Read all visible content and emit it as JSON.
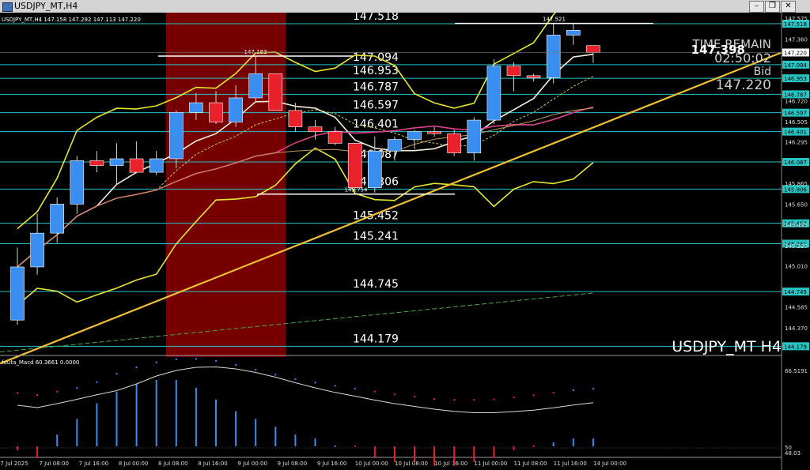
{
  "window": {
    "title": "USDJPY_MT,H4"
  },
  "header": {
    "symbol_info": "USDJPY_MT,H4 147.158 147.292 147.113 147.220",
    "indicator_info": "fuuta_Macd 60.3661  0.0000"
  },
  "overlay": {
    "time_remain_label": "TIME REMAIN",
    "time_remain": "02:50:02",
    "price_big": "147.398",
    "bid_label": "Bid",
    "bid_value": "147.220",
    "symbol_label": "USDJPY_MT H4"
  },
  "colors": {
    "bull": "#3a8ef0",
    "bear": "#e8212b",
    "bollinger": "#e6e62a",
    "trendline": "#f0c030",
    "ma_white": "#f2eedb",
    "ma_pink": "#e0408a",
    "level_line": "#27c4c4",
    "shade": "#8b0000"
  },
  "chart_data": {
    "type": "candlestick",
    "title": "USDJPY_MT H4",
    "y_range": [
      144.1,
      147.6
    ],
    "price_axis_ticks": [
      "147.575",
      "147.360",
      "147.220",
      "146.720",
      "146.505",
      "146.295",
      "145.865",
      "145.650",
      "145.435",
      "145.220",
      "145.010",
      "144.585",
      "144.370"
    ],
    "x_labels": [
      "7 Jul 2025",
      "7 Jul 08:00",
      "7 Jul 16:00",
      "8 Jul 00:00",
      "8 Jul 08:00",
      "8 Jul 16:00",
      "9 Jul 00:00",
      "9 Jul 08:00",
      "9 Jul 16:00",
      "10 Jul 00:00",
      "10 Jul 08:00",
      "10 Jul 16:00",
      "11 Jul 00:00",
      "11 Jul 08:00",
      "11 Jul 16:00",
      "14 Jul 00:00"
    ],
    "candles": [
      {
        "o": 144.45,
        "h": 145.2,
        "l": 144.4,
        "c": 145.0
      },
      {
        "o": 145.0,
        "h": 145.55,
        "l": 144.92,
        "c": 145.35
      },
      {
        "o": 145.35,
        "h": 145.72,
        "l": 145.25,
        "c": 145.65
      },
      {
        "o": 145.65,
        "h": 146.15,
        "l": 145.55,
        "c": 146.1
      },
      {
        "o": 146.1,
        "h": 146.2,
        "l": 145.98,
        "c": 146.05
      },
      {
        "o": 146.05,
        "h": 146.28,
        "l": 145.85,
        "c": 146.12
      },
      {
        "o": 146.12,
        "h": 146.3,
        "l": 145.97,
        "c": 145.98
      },
      {
        "o": 145.98,
        "h": 146.2,
        "l": 145.95,
        "c": 146.12
      },
      {
        "o": 146.12,
        "h": 146.62,
        "l": 146.02,
        "c": 146.6
      },
      {
        "o": 146.6,
        "h": 146.8,
        "l": 146.52,
        "c": 146.7
      },
      {
        "o": 146.7,
        "h": 146.82,
        "l": 146.48,
        "c": 146.5
      },
      {
        "o": 146.5,
        "h": 146.88,
        "l": 146.45,
        "c": 146.75
      },
      {
        "o": 146.75,
        "h": 147.18,
        "l": 146.7,
        "c": 147.0
      },
      {
        "o": 147.0,
        "h": 147.0,
        "l": 146.62,
        "c": 146.62
      },
      {
        "o": 146.62,
        "h": 146.7,
        "l": 146.4,
        "c": 146.45
      },
      {
        "o": 146.45,
        "h": 146.52,
        "l": 146.32,
        "c": 146.4
      },
      {
        "o": 146.4,
        "h": 146.45,
        "l": 146.26,
        "c": 146.28
      },
      {
        "o": 146.28,
        "h": 146.28,
        "l": 145.78,
        "c": 145.82
      },
      {
        "o": 145.82,
        "h": 146.35,
        "l": 145.77,
        "c": 146.2
      },
      {
        "o": 146.2,
        "h": 146.35,
        "l": 146.1,
        "c": 146.32
      },
      {
        "o": 146.32,
        "h": 146.42,
        "l": 146.22,
        "c": 146.4
      },
      {
        "o": 146.4,
        "h": 146.45,
        "l": 146.35,
        "c": 146.38
      },
      {
        "o": 146.38,
        "h": 146.42,
        "l": 146.15,
        "c": 146.18
      },
      {
        "o": 146.18,
        "h": 146.55,
        "l": 146.1,
        "c": 146.52
      },
      {
        "o": 146.52,
        "h": 147.15,
        "l": 146.48,
        "c": 147.08
      },
      {
        "o": 147.08,
        "h": 147.12,
        "l": 146.82,
        "c": 146.98
      },
      {
        "o": 146.98,
        "h": 147.0,
        "l": 146.92,
        "c": 146.96
      },
      {
        "o": 146.96,
        "h": 147.521,
        "l": 146.9,
        "c": 147.4
      },
      {
        "o": 147.4,
        "h": 147.521,
        "l": 147.3,
        "c": 147.45
      },
      {
        "o": 147.292,
        "h": 147.292,
        "l": 147.113,
        "c": 147.22
      }
    ],
    "levels": [
      147.518,
      147.094,
      146.953,
      146.787,
      146.597,
      146.401,
      146.087,
      145.806,
      145.452,
      145.241,
      144.745,
      144.179
    ],
    "annotations": [
      {
        "text": "147.183",
        "price": 147.183
      },
      {
        "text": "145.754",
        "price": 145.754
      },
      {
        "text": "147.521",
        "price": 147.521
      }
    ],
    "current_price": 147.22,
    "macd": {
      "name": "fuuta_Macd",
      "range_labels": [
        "66.5191",
        "50",
        "48.03"
      ],
      "histogram": [
        -1,
        -3,
        3,
        7,
        11,
        14,
        16,
        17,
        17,
        15,
        12,
        9,
        7,
        5,
        3,
        2,
        0.5,
        -0.5,
        -3,
        -4,
        -4,
        -5,
        -5,
        -4,
        -3,
        -1,
        -0.5,
        1,
        2,
        2
      ]
    }
  }
}
